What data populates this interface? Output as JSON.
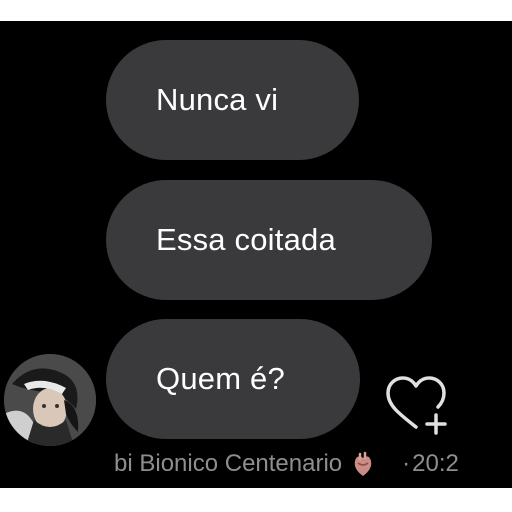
{
  "messages": [
    {
      "text": "Nunca vi"
    },
    {
      "text": "Essa coitada"
    },
    {
      "text": "Quem é?"
    }
  ],
  "reaction": {
    "user": "bi Bionico Centenario",
    "emoji_icon": "anatomical-heart-icon",
    "separator": "·",
    "time": "20:2"
  },
  "icons": {
    "react": "heart-plus-icon",
    "avatar": "user-avatar"
  },
  "colors": {
    "background": "#000000",
    "bubble": "#3a3a3c",
    "text": "#ffffff",
    "meta_text": "#8e8e8e"
  }
}
